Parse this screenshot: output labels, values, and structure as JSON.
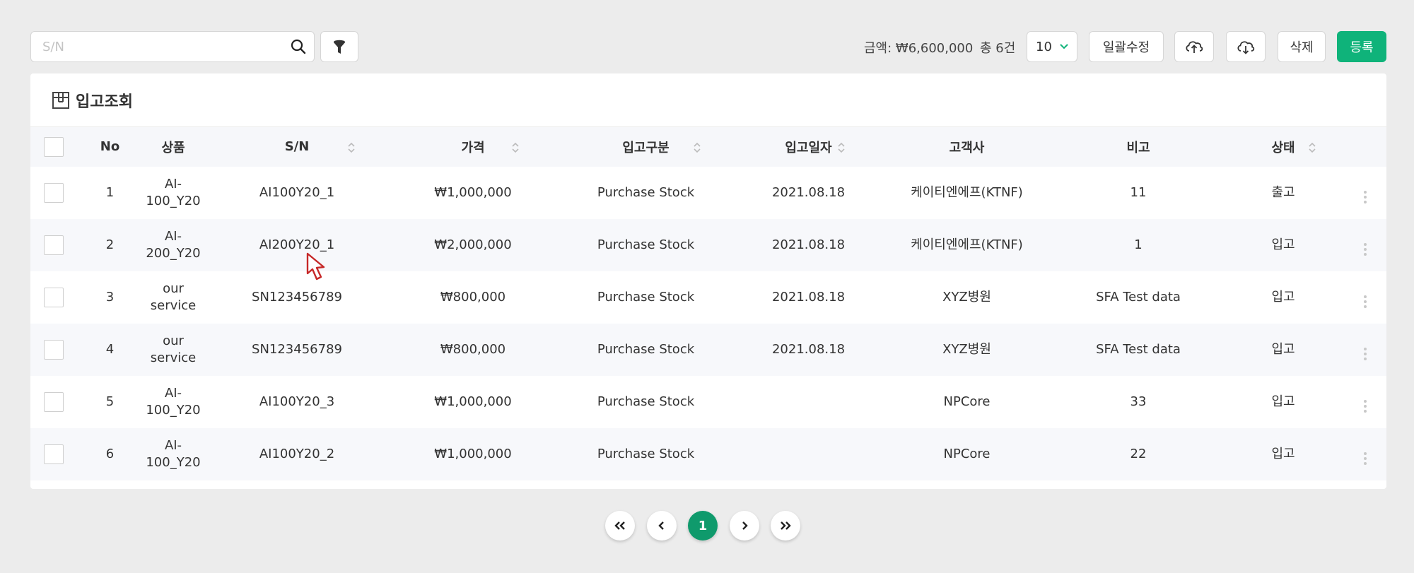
{
  "toolbar": {
    "search_placeholder": "S/N",
    "total_amount": "금액: ₩6,600,000",
    "total_count": "총 6건",
    "page_size": "10",
    "bulk_edit_label": "일괄수정",
    "delete_label": "삭제",
    "register_label": "등록"
  },
  "card": {
    "title": "입고조회"
  },
  "table": {
    "headers": {
      "no": "No",
      "product": "상품",
      "sn": "S/N",
      "price": "가격",
      "receipt_type": "입고구분",
      "receipt_date": "입고일자",
      "customer": "고객사",
      "note": "비고",
      "status": "상태"
    },
    "rows": [
      {
        "no": "1",
        "product_line1": "AI-",
        "product_line2": "100_Y20",
        "sn": "AI100Y20_1",
        "price": "₩1,000,000",
        "receipt_type": "Purchase Stock",
        "receipt_date": "2021.08.18",
        "customer": "케이티엔에프(KTNF)",
        "note": "11",
        "status": "출고"
      },
      {
        "no": "2",
        "product_line1": "AI-",
        "product_line2": "200_Y20",
        "sn": "AI200Y20_1",
        "price": "₩2,000,000",
        "receipt_type": "Purchase Stock",
        "receipt_date": "2021.08.18",
        "customer": "케이티엔에프(KTNF)",
        "note": "1",
        "status": "입고"
      },
      {
        "no": "3",
        "product_line1": "our",
        "product_line2": "service",
        "sn": "SN123456789",
        "price": "₩800,000",
        "receipt_type": "Purchase Stock",
        "receipt_date": "2021.08.18",
        "customer": "XYZ병원",
        "note": "SFA Test data",
        "status": "입고"
      },
      {
        "no": "4",
        "product_line1": "our",
        "product_line2": "service",
        "sn": "SN123456789",
        "price": "₩800,000",
        "receipt_type": "Purchase Stock",
        "receipt_date": "2021.08.18",
        "customer": "XYZ병원",
        "note": "SFA Test data",
        "status": "입고"
      },
      {
        "no": "5",
        "product_line1": "AI-",
        "product_line2": "100_Y20",
        "sn": "AI100Y20_3",
        "price": "₩1,000,000",
        "receipt_type": "Purchase Stock",
        "receipt_date": "",
        "customer": "NPCore",
        "note": "33",
        "status": "입고"
      },
      {
        "no": "6",
        "product_line1": "AI-",
        "product_line2": "100_Y20",
        "sn": "AI100Y20_2",
        "price": "₩1,000,000",
        "receipt_type": "Purchase Stock",
        "receipt_date": "",
        "customer": "NPCore",
        "note": "22",
        "status": "입고"
      }
    ]
  },
  "pagination": {
    "current_page": "1"
  },
  "icons": {
    "search": "search-icon",
    "filter": "filter-icon",
    "chevron": "chevron-down-icon",
    "upload": "cloud-upload-icon",
    "download": "cloud-download-icon",
    "box": "box-icon",
    "sort": "sort-icon",
    "more": "kebab-menu-icon",
    "cursor": "mouse-cursor-icon"
  },
  "colors": {
    "accent": "#0fb37a",
    "active_page": "#0f9a6c",
    "background": "#ececec"
  }
}
